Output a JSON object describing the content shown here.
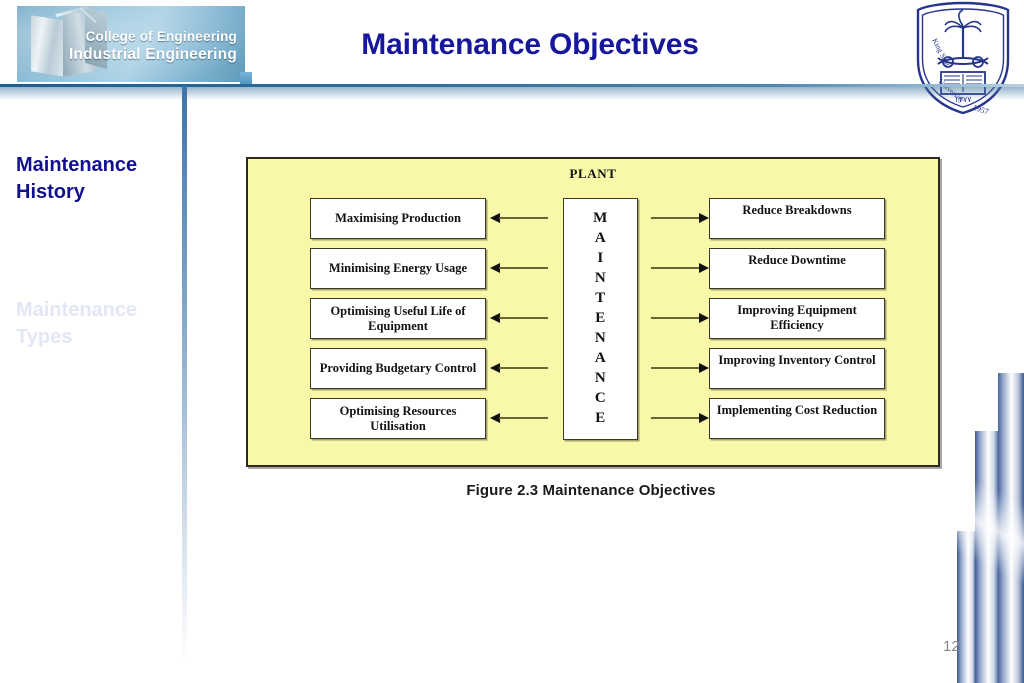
{
  "header": {
    "title": "Maintenance Objectives",
    "college_logo": {
      "line1": "College of Engineering",
      "line2": "Industrial Engineering",
      "icon": "engineering-banner-icon"
    },
    "university_logo": {
      "name": "king-saud-university-crest-icon",
      "text_outer": "King Saud University",
      "year": "1957",
      "hijri": "١٣٧٧"
    }
  },
  "sidebar": {
    "items": [
      {
        "label": "Maintenance History",
        "state": "active"
      },
      {
        "label": "Maintenance Types",
        "state": "dimmed"
      }
    ]
  },
  "figure": {
    "panel_label": "PLANT",
    "center_box": {
      "word": "MAINTENANCE",
      "letters": [
        "M",
        "A",
        "I",
        "N",
        "T",
        "E",
        "N",
        "A",
        "N",
        "C",
        "E"
      ]
    },
    "left_objectives": [
      "Maximising Production",
      "Minimising Energy Usage",
      "Optimising Useful Life of Equipment",
      "Providing Budgetary Control",
      "Optimising Resources Utilisation"
    ],
    "right_objectives": [
      "Reduce Breakdowns",
      "Reduce Downtime",
      "Improving Equipment Efficiency",
      "Improving Inventory Control",
      "Implementing Cost Reduction"
    ],
    "caption": "Figure 2.3  Maintenance Objectives",
    "colors": {
      "panel_fill": "#f9f7a8",
      "panel_border": "#2a2a22",
      "box_fill": "#ffffff",
      "arrow": "#6b6534"
    }
  },
  "footer": {
    "page_number": "12"
  }
}
